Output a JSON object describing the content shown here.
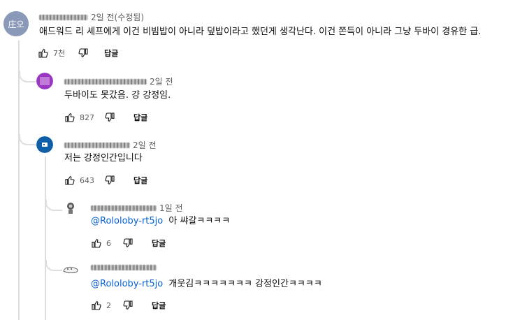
{
  "comments": [
    {
      "author_hidden": true,
      "time": "2일 전(수정됨)",
      "text": "애드워드 리 셰프에게 이건 비빔밥이 아니라 덮밥이라고 했던게 생각난다. 이건 쫀득이 아니라 그냥 두바이 경유한 급.",
      "likes": "7천",
      "reply_label": "답글",
      "avatar_color": "#8a99b8"
    },
    {
      "author_hidden": true,
      "time": "2일 전",
      "text": "두바이도 못갔음. 걍 강정임.",
      "likes": "827",
      "reply_label": "답글",
      "avatar_color": "#9c37c4"
    },
    {
      "author_hidden": true,
      "time": "2일 전",
      "text": "저는 강정인간입니다",
      "likes": "643",
      "reply_label": "답글",
      "avatar_color": "#0f5fa8"
    },
    {
      "author_hidden": true,
      "time": "1일 전",
      "mention": "@Rololoby-rt5jo",
      "text": "아 쌰갈ㅋㅋㅋㅋ",
      "likes": "6",
      "reply_label": "답글",
      "avatar_color": "#555555"
    },
    {
      "author_hidden": true,
      "time": "",
      "mention": "@Rololoby-rt5jo",
      "text": "개웃김ㅋㅋㅋㅋㅋㅋㅋ 강정인간ㅋㅋㅋㅋ",
      "likes": "2",
      "reply_label": "답글",
      "avatar_color": "#e6e6e6"
    }
  ],
  "icons": {
    "like": "thumbs-up-icon",
    "dislike": "thumbs-down-icon"
  }
}
